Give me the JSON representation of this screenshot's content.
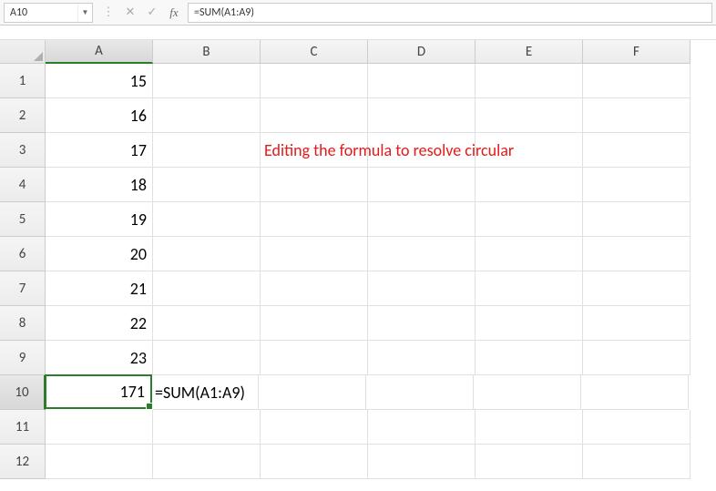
{
  "formulaBar": {
    "nameBox": "A10",
    "formula": "=SUM(A1:A9)"
  },
  "columns": [
    "A",
    "B",
    "C",
    "D",
    "E",
    "F"
  ],
  "rows": [
    "1",
    "2",
    "3",
    "4",
    "5",
    "6",
    "7",
    "8",
    "9",
    "10",
    "11",
    "12"
  ],
  "cells": {
    "A1": "15",
    "A2": "16",
    "A3": "17",
    "A4": "18",
    "A5": "19",
    "A6": "20",
    "A7": "21",
    "A8": "22",
    "A9": "23",
    "A10": "171",
    "B10": "=SUM(A1:A9)"
  },
  "overlayText": "Editing the formula to resolve circular",
  "selectedCell": "A10",
  "highlightedCol": "A",
  "highlightedRow": "10"
}
